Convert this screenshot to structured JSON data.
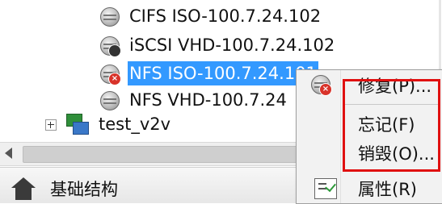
{
  "tree": {
    "items": [
      {
        "label": "CIFS ISO-100.7.24.102",
        "icon": "storage-icon",
        "badge": "none",
        "selected": false
      },
      {
        "label": "iSCSI VHD-100.7.24.102",
        "icon": "storage-icon",
        "badge": "dark",
        "selected": false
      },
      {
        "label": "NFS ISO-100.7.24.101",
        "icon": "storage-icon",
        "badge": "error",
        "selected": true
      },
      {
        "label": "NFS VHD-100.7.24",
        "icon": "storage-icon",
        "badge": "none",
        "selected": false
      }
    ],
    "group": {
      "label": "test_v2v",
      "icon": "vm-group-icon"
    }
  },
  "nav": {
    "label": "基础结构"
  },
  "context_menu": {
    "items": [
      {
        "label": "修复(P)...",
        "icon": "storage-error-icon"
      },
      {
        "label": "忘记(F)"
      },
      {
        "label": "销毁(O)..."
      },
      {
        "label": "属性(R)",
        "icon": "properties-icon"
      }
    ]
  },
  "colors": {
    "selection": "#3399ff",
    "highlight_border": "#e01010"
  }
}
